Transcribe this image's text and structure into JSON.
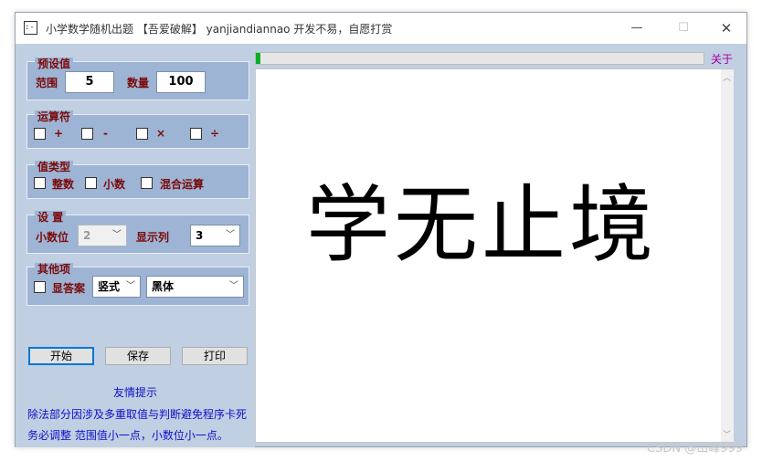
{
  "window": {
    "title": "小学数学随机出题 【吾爱破解】 yanjiandiannao 开发不易，自愿打赏",
    "icon_label": ":-:"
  },
  "presets": {
    "title": "预设值",
    "range_label": "范围",
    "range_value": "5",
    "count_label": "数量",
    "count_value": "100"
  },
  "operators": {
    "title": "运算符",
    "items": [
      "+",
      "-",
      "×",
      "÷"
    ]
  },
  "value_type": {
    "title": "值类型",
    "items": [
      "整数",
      "小数",
      "混合运算"
    ]
  },
  "settings": {
    "title": "设 置",
    "decimal_label": "小数位",
    "decimal_value": "2",
    "columns_label": "显示列",
    "columns_value": "3"
  },
  "other": {
    "title": "其他项",
    "show_answer_label": "显答案",
    "layout_value": "竖式",
    "font_value": "黑体"
  },
  "buttons": {
    "start": "开始",
    "save": "保存",
    "print": "打印"
  },
  "tips": {
    "title": "友情提示",
    "line1": "除法部分因涉及多重取值与判断避免程序卡死",
    "line2": "务必调整 范围值小一点，小数位小一点。"
  },
  "progress": {
    "value": 0.01,
    "color": "#06b025"
  },
  "about_label": "关于",
  "content_text": "学无止境",
  "watermark": "CSDN @山峰999",
  "colors": {
    "group_bg": "#9eb4d4",
    "label_color": "#7a0a0a",
    "tip_color": "#1010c8",
    "about_color": "#a000a0"
  }
}
